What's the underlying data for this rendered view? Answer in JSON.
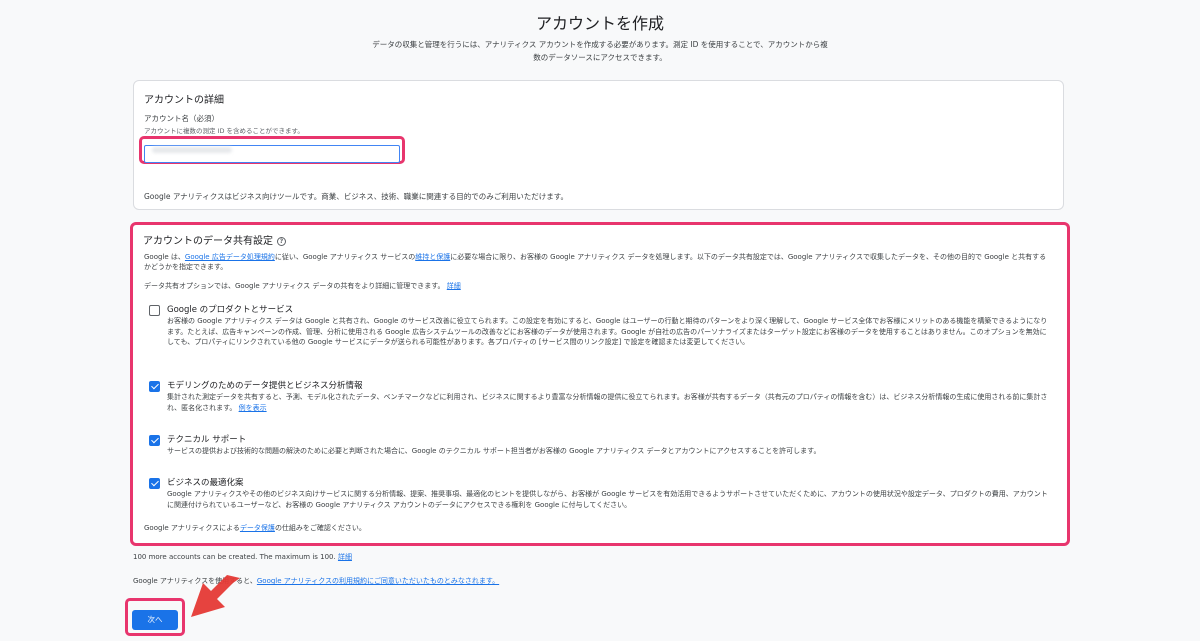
{
  "page": {
    "title": "アカウントを作成",
    "intro": "データの収集と管理を行うには、アナリティクス アカウントを作成する必要があります。測定 ID を使用することで、アカウントから複数のデータソースにアクセスできます。"
  },
  "account_details": {
    "section_title": "アカウントの詳細",
    "name_label": "アカウント名（必須）",
    "name_sublabel": "アカウントに複数の測定 ID を含めることができます。",
    "name_value": "",
    "business_note": "Google アナリティクスはビジネス向けツールです。商業、ビジネス、技術、職業に関連する目的でのみご利用いただけます。"
  },
  "data_sharing": {
    "section_title": "アカウントのデータ共有設定",
    "help_icon": "?",
    "intro_pre": "Google は、",
    "intro_link1": "Google 広告データ処理規約",
    "intro_mid": "に従い、Google アナリティクス サービスの",
    "intro_link2": "維持と保護",
    "intro_post": "に必要な場合に限り、お客様の Google アナリティクス データを処理します。以下のデータ共有設定では、Google アナリティクスで収集したデータを、その他の目的で Google と共有するかどうかを指定できます。",
    "options_note": "データ共有オプションでは、Google アナリティクス データの共有をより詳細に管理できます。",
    "options_note_link": "詳細",
    "options": [
      {
        "title": "Google のプロダクトとサービス",
        "checked": false,
        "desc": "お客様の Google アナリティクス データは Google と共有され、Google のサービス改善に役立てられます。この設定を有効にすると、Google はユーザーの行動と期待のパターンをより深く理解して、Google サービス全体でお客様にメリットのある機能を構築できるようになります。たとえば、広告キャンペーンの作成、管理、分析に使用される Google 広告システムツールの改善などにお客様のデータが使用されます。Google が自社の広告のパーソナライズまたはターゲット設定にお客様のデータを使用することはありません。このオプションを無効にしても、プロパティにリンクされている他の Google サービスにデータが送られる可能性があります。各プロパティの [サービス間のリンク設定] で設定を確認または変更してください。",
        "link": ""
      },
      {
        "title": "モデリングのためのデータ提供とビジネス分析情報",
        "checked": true,
        "desc": "集計された測定データを共有すると、予測、モデル化されたデータ、ベンチマークなどに利用され、ビジネスに関するより豊富な分析情報の提供に役立てられます。お客様が共有するデータ（共有元のプロパティの情報を含む）は、ビジネス分析情報の生成に使用される前に集計され、匿名化されます。",
        "link": "例を表示"
      },
      {
        "title": "テクニカル サポート",
        "checked": true,
        "desc": "サービスの提供および技術的な問題の解決のために必要と判断された場合に、Google のテクニカル サポート担当者がお客様の Google アナリティクス データとアカウントにアクセスすることを許可します。",
        "link": ""
      },
      {
        "title": "ビジネスの最適化案",
        "checked": true,
        "desc": "Google アナリティクスやその他のビジネス向けサービスに関する分析情報、提案、推奨事項、最適化のヒントを提供しながら、お客様が Google サービスを有効活用できるようサポートさせていただくために、アカウントの使用状況や設定データ、プロダクトの費用、アカウントに関連付けられているユーザーなど、お客様の Google アナリティクス アカウントのデータにアクセスできる権利を Google に付与してください。",
        "link": ""
      }
    ],
    "protection_pre": "Google アナリティクスによる",
    "protection_link": "データ保護",
    "protection_post": "の仕組みをご確認ください。"
  },
  "footer": {
    "accounts_text": "100 more accounts can be created. The maximum is 100.",
    "accounts_link": "詳細",
    "terms_pre": "Google アナリティクスを使用すると、",
    "terms_link": "Google アナリティクスの利用規約にご同意いただいたものとみなされます。"
  },
  "actions": {
    "next_label": "次へ"
  },
  "colors": {
    "accent": "#1a73e8",
    "highlight": "#e8356d",
    "arrow": "#e53935"
  }
}
